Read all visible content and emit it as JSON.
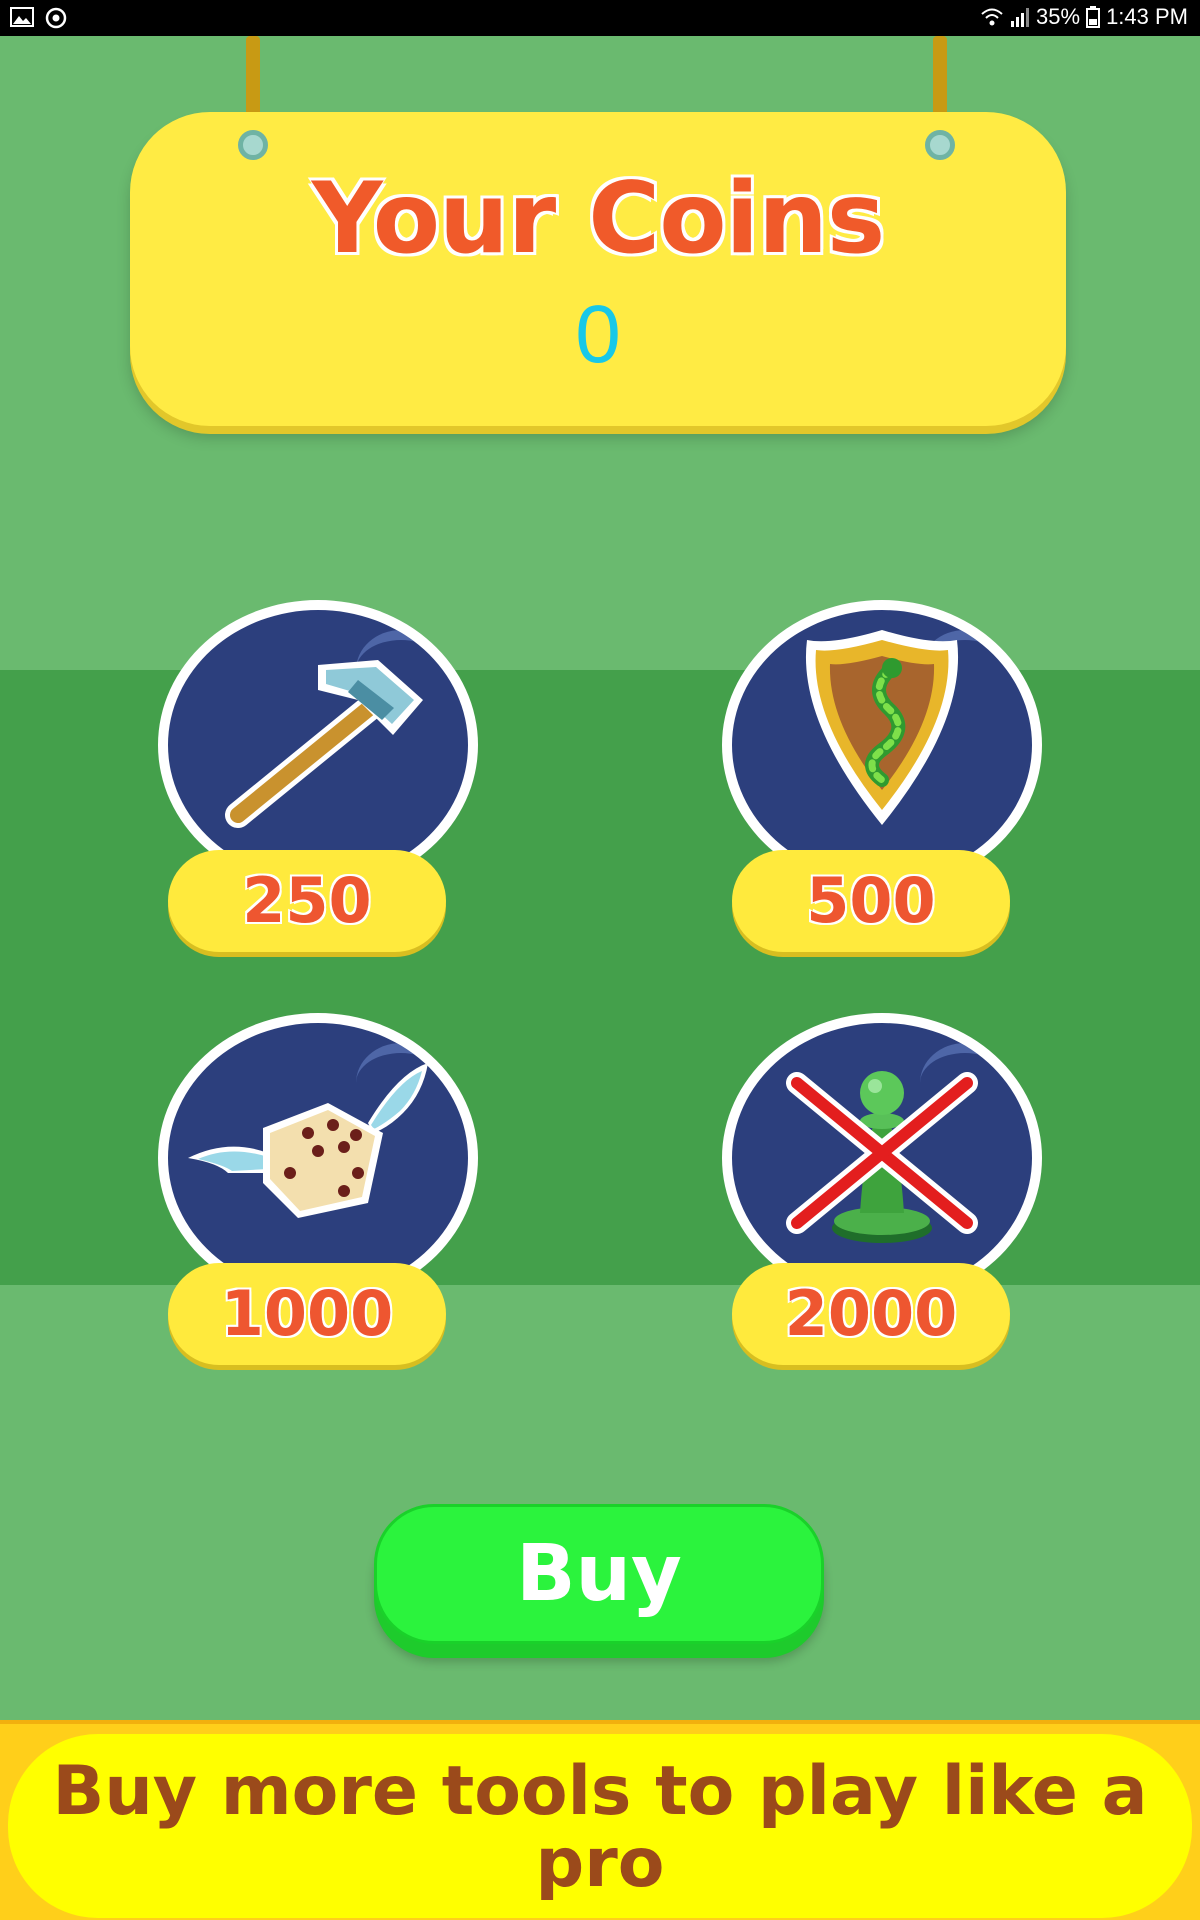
{
  "status_bar": {
    "battery": "35%",
    "time": "1:43 PM",
    "icons": [
      "image-icon",
      "sync-icon",
      "wifi-icon",
      "signal-icon",
      "battery-icon"
    ]
  },
  "coins_panel": {
    "title": "Your Coins",
    "value": "0"
  },
  "shop_items": [
    {
      "name": "hammer",
      "icon": "hammer-icon",
      "price": "250"
    },
    {
      "name": "snake shield",
      "icon": "shield-snake-icon",
      "price": "500"
    },
    {
      "name": "flying dice",
      "icon": "winged-dice-icon",
      "price": "1000"
    },
    {
      "name": "remove pawn",
      "icon": "pawn-cross-icon",
      "price": "2000"
    }
  ],
  "buy_button": {
    "label": "Buy"
  },
  "banner": {
    "text": "Buy more tools to play like a pro"
  },
  "colors": {
    "background": "#6aba6f",
    "band": "#44a04b",
    "panel_yellow": "#ffeb44",
    "title_orange": "#f05a2a",
    "coin_cyan": "#18c8e8",
    "circle_navy": "#2c3f7d",
    "buy_green": "#2bf33d",
    "banner_text": "#9b4a1b"
  }
}
